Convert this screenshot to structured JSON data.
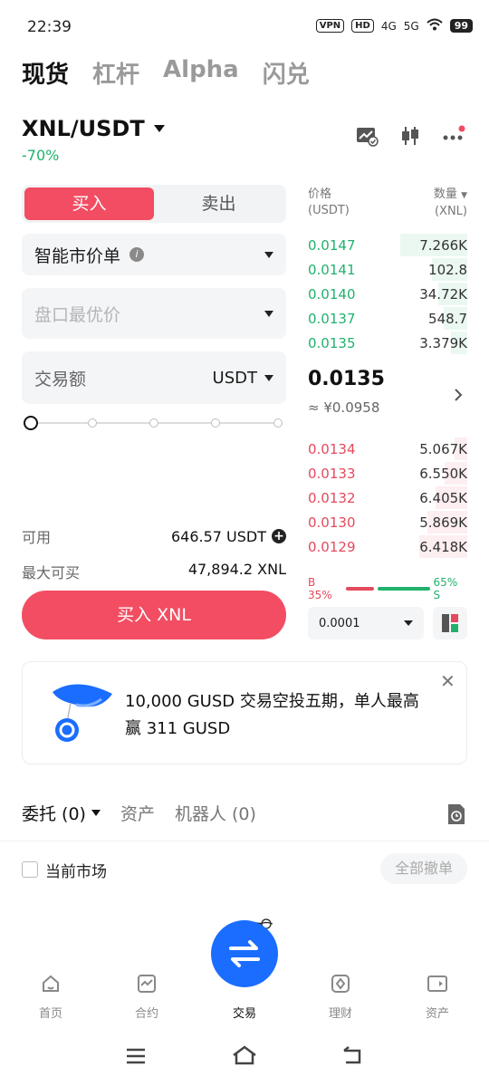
{
  "status": {
    "time": "22:39",
    "vpn": "VPN",
    "hd": "HD",
    "net1": "4G",
    "net2": "5G",
    "battery": "99"
  },
  "tabs": [
    "现货",
    "杠杆",
    "Alpha",
    "闪兑"
  ],
  "pair": {
    "symbol": "XNL/USDT",
    "change": "-70%"
  },
  "trade": {
    "buy_label": "买入",
    "sell_label": "卖出",
    "order_type": "智能市价单",
    "price_placeholder": "盘口最优价",
    "amount_label": "交易额",
    "amount_unit": "USDT",
    "available_label": "可用",
    "available_value": "646.57 USDT",
    "max_label": "最大可买",
    "max_value": "47,894.2 XNL",
    "submit_label": "买入 XNL"
  },
  "orderbook": {
    "price_header": "价格",
    "price_unit": "(USDT)",
    "qty_header": "数量",
    "qty_unit": "(XNL)",
    "asks": [
      {
        "price": "0.0147",
        "qty": "7.266K",
        "depth": 0.42
      },
      {
        "price": "0.0141",
        "qty": "102.8",
        "depth": 0.22
      },
      {
        "price": "0.0140",
        "qty": "34.72K",
        "depth": 0.18
      },
      {
        "price": "0.0137",
        "qty": "548.7",
        "depth": 0.15
      },
      {
        "price": "0.0135",
        "qty": "3.379K",
        "depth": 0.1
      }
    ],
    "mid_price": "0.0135",
    "mid_cny": "≈ ¥0.0958",
    "bids": [
      {
        "price": "0.0134",
        "qty": "5.067K",
        "depth": 0.08
      },
      {
        "price": "0.0133",
        "qty": "6.550K",
        "depth": 0.14
      },
      {
        "price": "0.0132",
        "qty": "6.405K",
        "depth": 0.2
      },
      {
        "price": "0.0130",
        "qty": "5.869K",
        "depth": 0.25
      },
      {
        "price": "0.0129",
        "qty": "6.418K",
        "depth": 0.3
      }
    ],
    "buy_ratio": "B 35%",
    "sell_ratio": "65% S",
    "buy_pct": 35,
    "depth": "0.0001"
  },
  "promo": {
    "text": "10,000 GUSD 交易空投五期，单人最高赢 311 GUSD"
  },
  "orders": {
    "tab_orders": "委托 (0)",
    "tab_assets": "资产",
    "tab_bots": "机器人 (0)",
    "current_market": "当前市场",
    "cancel_all": "全部撤单"
  },
  "nav": [
    "首页",
    "合约",
    "交易",
    "理财",
    "资产"
  ],
  "colors": {
    "buy": "#f24d62",
    "up": "#20b26c",
    "accent": "#1a6dff"
  }
}
